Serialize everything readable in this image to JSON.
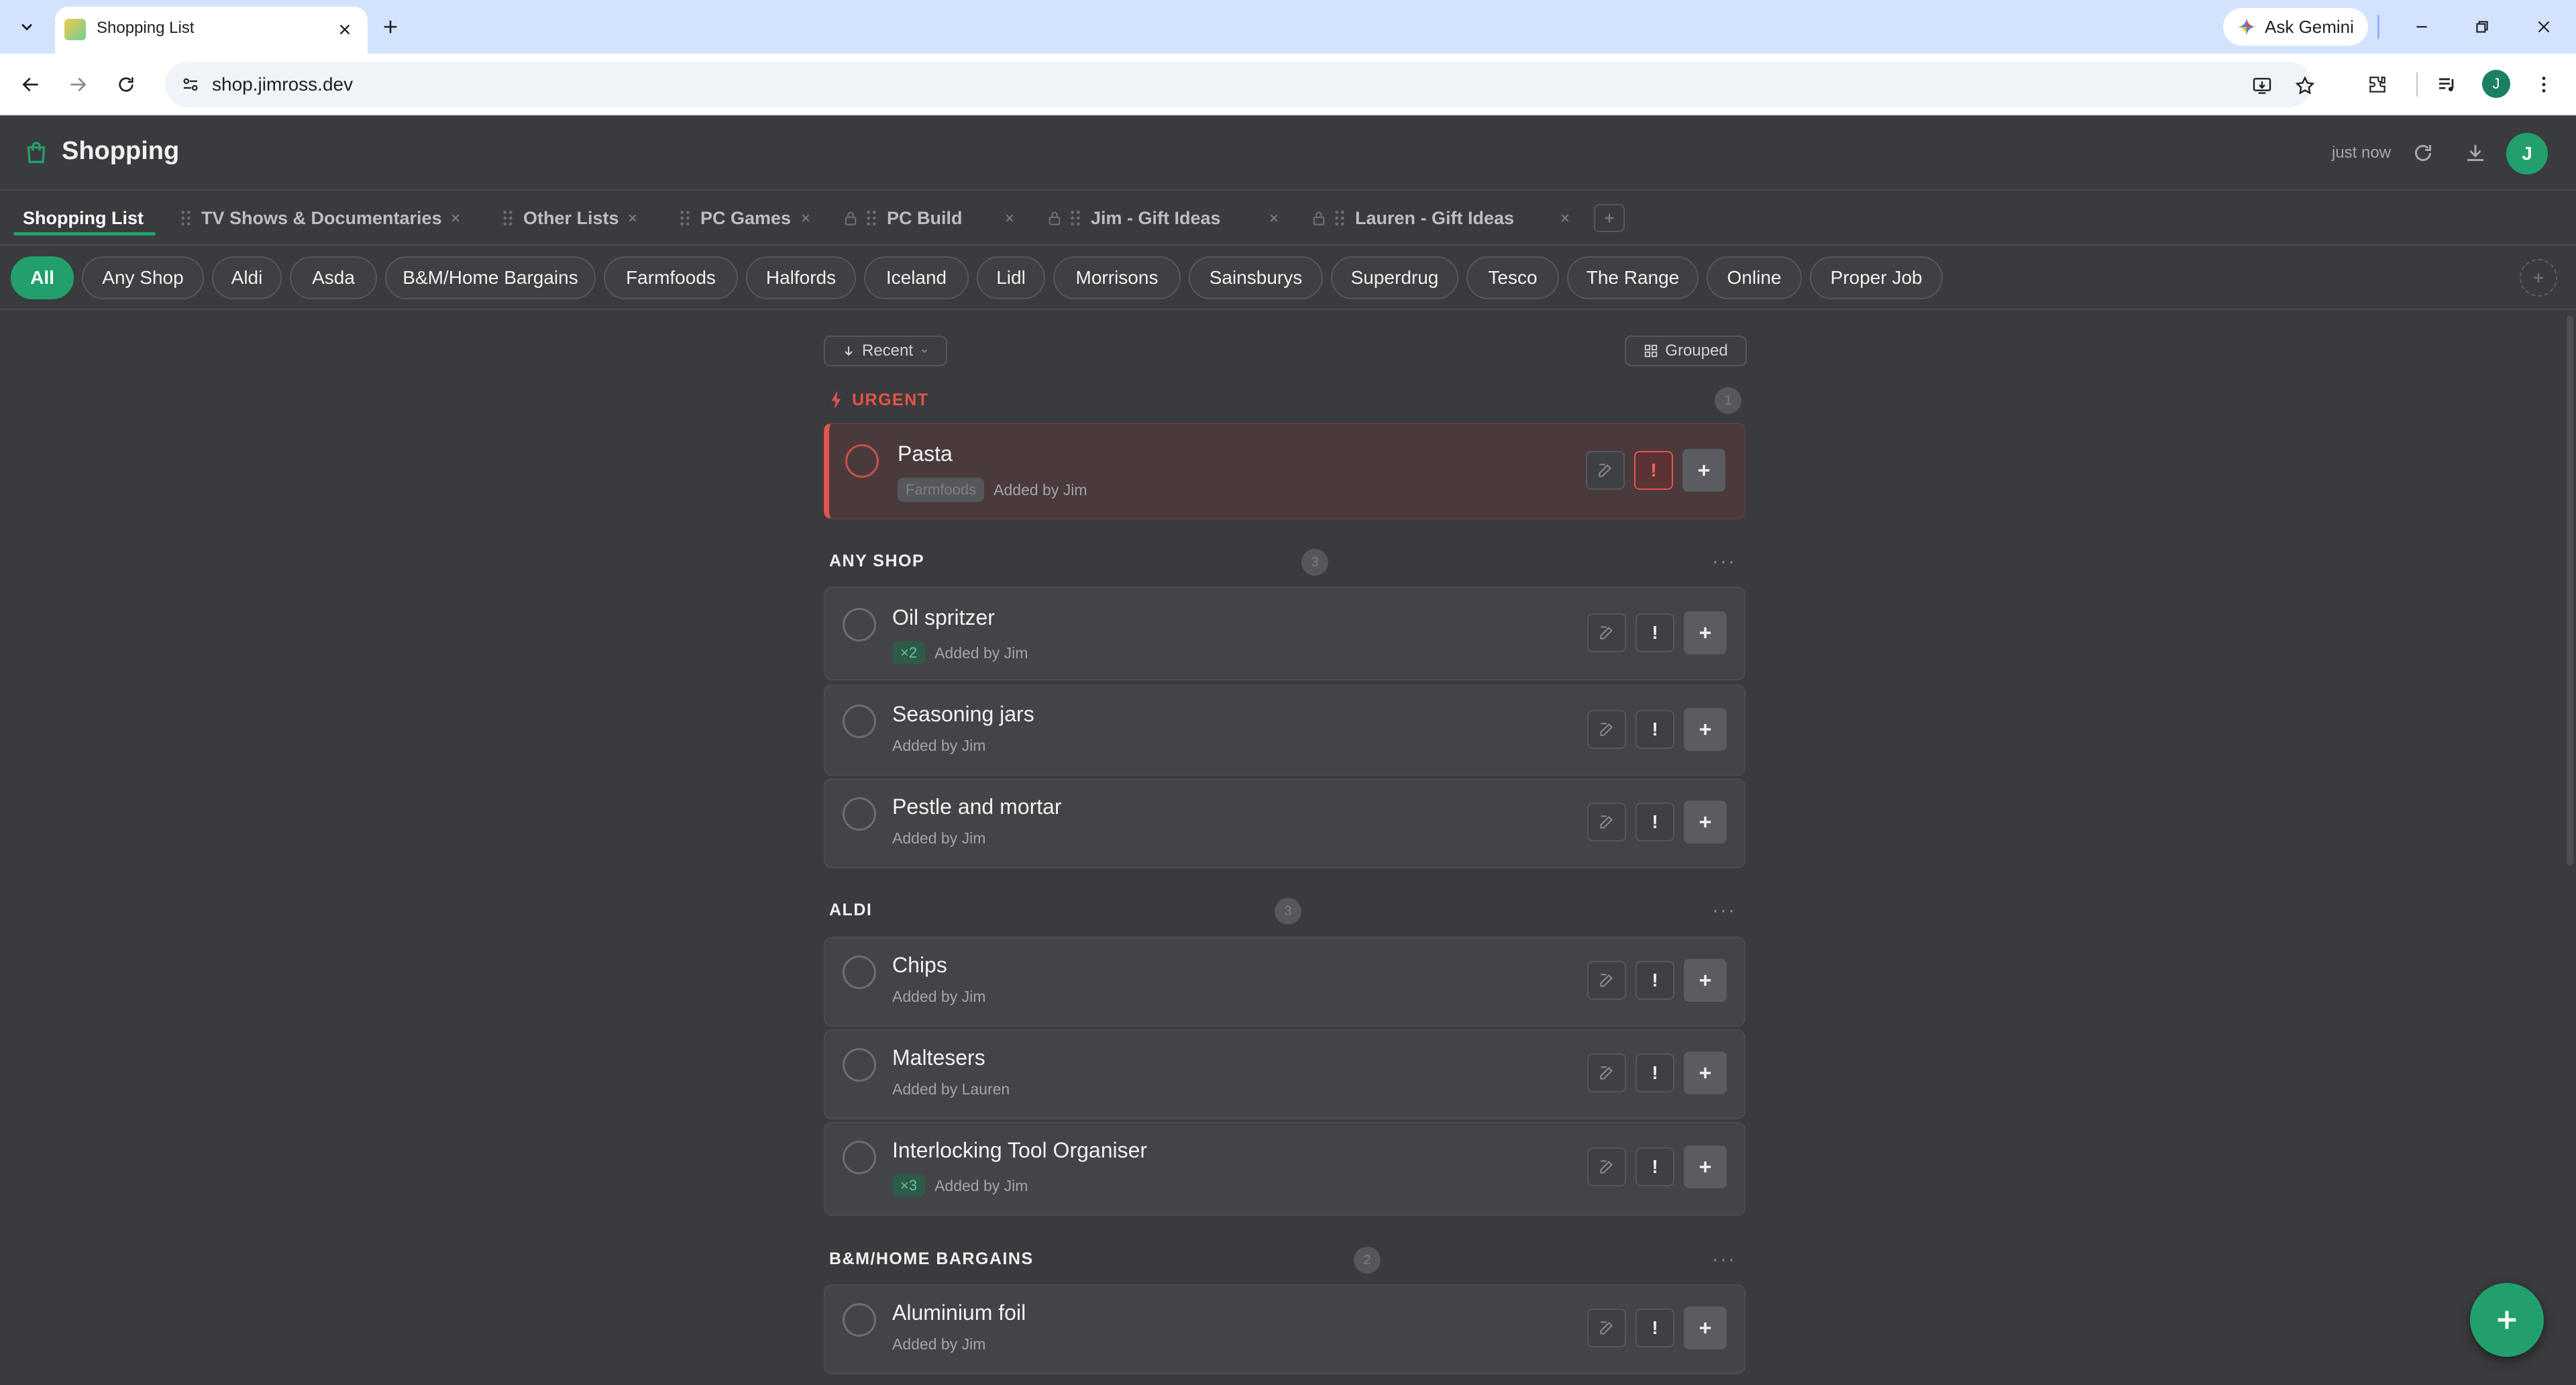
{
  "browser": {
    "tab_title": "Shopping List",
    "url": "shop.jimross.dev",
    "gemini_label": "Ask Gemini",
    "profile_initial": "J"
  },
  "app": {
    "title": "Shopping",
    "sync_status": "just now",
    "avatar_initial": "J",
    "accent_color": "#22a06b",
    "urgent_color": "#e5534b"
  },
  "list_tabs": [
    {
      "label": "Shopping List",
      "active": true
    },
    {
      "label": "TV Shows & Documentaries"
    },
    {
      "label": "Other Lists"
    },
    {
      "label": "PC Games"
    },
    {
      "label": "PC Build",
      "locked": true
    },
    {
      "label": "Jim - Gift Ideas",
      "locked": true
    },
    {
      "label": "Lauren - Gift Ideas",
      "locked": true
    }
  ],
  "shop_filters": [
    "All",
    "Any Shop",
    "Aldi",
    "Asda",
    "B&M/Home Bargains",
    "Farmfoods",
    "Halfords",
    "Iceland",
    "Lidl",
    "Morrisons",
    "Sainsburys",
    "Superdrug",
    "Tesco",
    "The Range",
    "Online",
    "Proper Job"
  ],
  "active_filter": "All",
  "controls": {
    "sort_label": "Recent",
    "view_label": "Grouped"
  },
  "sections": [
    {
      "title": "URGENT",
      "count": "1",
      "items": [
        {
          "name": "Pasta",
          "shop_tag": "Farmfoods",
          "added_by": "Added by Jim",
          "urgent": true
        }
      ]
    },
    {
      "title": "ANY SHOP",
      "count": "3",
      "items": [
        {
          "name": "Oil spritzer",
          "qty": "×2",
          "added_by": "Added by Jim"
        },
        {
          "name": "Seasoning jars",
          "added_by": "Added by Jim"
        },
        {
          "name": "Pestle and mortar",
          "added_by": "Added by Jim"
        }
      ]
    },
    {
      "title": "ALDI",
      "count": "3",
      "items": [
        {
          "name": "Chips",
          "added_by": "Added by Jim"
        },
        {
          "name": "Maltesers",
          "added_by": "Added by Lauren"
        },
        {
          "name": "Interlocking Tool Organiser",
          "qty": "×3",
          "added_by": "Added by Jim"
        }
      ]
    },
    {
      "title": "B&M/HOME BARGAINS",
      "count": "2",
      "items": [
        {
          "name": "Aluminium foil",
          "added_by": "Added by Jim"
        }
      ]
    }
  ],
  "icons": {
    "add_item": "plus-icon",
    "edit": "edit-icon",
    "urgent": "exclamation-icon"
  }
}
